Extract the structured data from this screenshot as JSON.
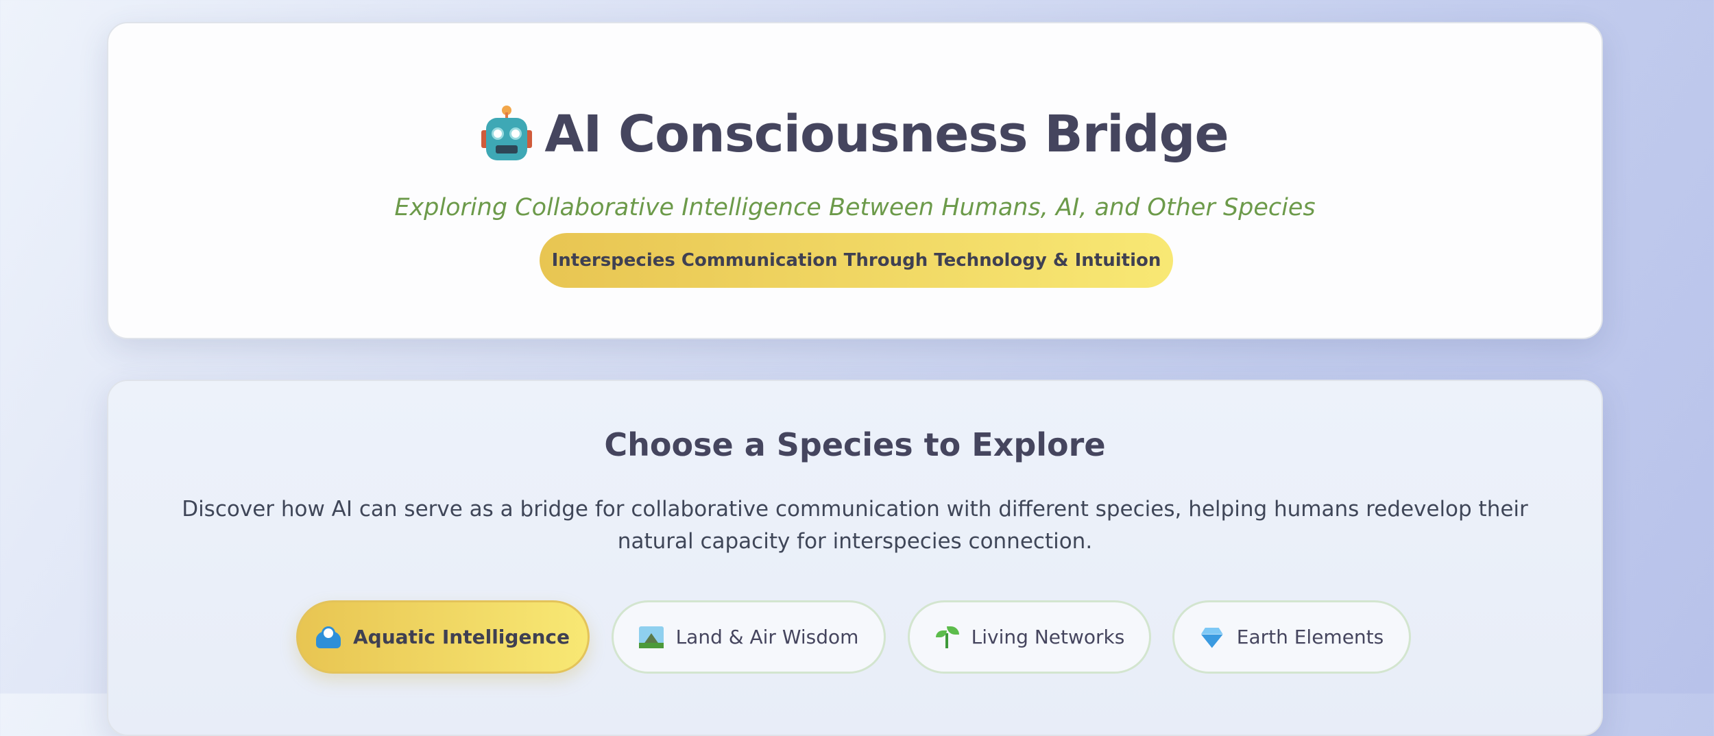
{
  "hero": {
    "title": "AI Consciousness Bridge",
    "title_icon": "robot-icon",
    "subtitle": "Exploring Collaborative Intelligence Between Humans, AI, and Other Species",
    "tagline": "Interspecies Communication Through Technology & Intuition"
  },
  "species": {
    "title": "Choose a Species to Explore",
    "description": "Discover how AI can serve as a bridge for collaborative communication with different species, helping humans redevelop their natural capacity for interspecies connection.",
    "buttons": [
      {
        "label": "Aquatic Intelligence",
        "icon": "wave-icon",
        "active": true
      },
      {
        "label": "Land & Air Wisdom",
        "icon": "landscape-icon",
        "active": false
      },
      {
        "label": "Living Networks",
        "icon": "seedling-icon",
        "active": false
      },
      {
        "label": "Earth Elements",
        "icon": "gem-icon",
        "active": false
      }
    ]
  },
  "colors": {
    "title_text": "#45455e",
    "subtitle_text": "#6c9a4a",
    "accent_gradient_start": "#e8c552",
    "accent_gradient_end": "#f8e874",
    "button_border": "#d3e5cf"
  }
}
